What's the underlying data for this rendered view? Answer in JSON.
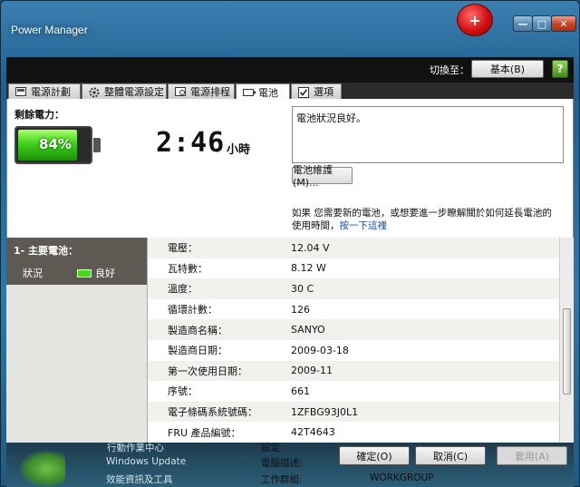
{
  "window": {
    "title": "Power Manager",
    "badge_icon": "battery-plus-icon",
    "min_label": "—",
    "max_label": "□",
    "close_label": "✕"
  },
  "header": {
    "switch_label": "切換至：",
    "basic_button": "基本(B)",
    "help_label": "?"
  },
  "tabs": [
    {
      "label": "電源計劃",
      "icon": "power-plan-icon"
    },
    {
      "label": "整體電源設定",
      "icon": "gear-icon"
    },
    {
      "label": "電源排程",
      "icon": "schedule-icon"
    },
    {
      "label": "電池",
      "icon": "battery-icon",
      "active": true
    },
    {
      "label": "選項",
      "icon": "checkbox-icon"
    }
  ],
  "battery": {
    "remaining_label": "剩餘電力：",
    "percent_text": "84%",
    "percent_value": 84,
    "time_text": "2:46",
    "time_unit": "小時",
    "status_text": "電池狀況良好。",
    "maintenance_button": "電池維護(M)...",
    "hint_text": "如果 您需要新的電池，或想要進一步瞭解關於如何延長電池的 使用時間，",
    "hint_link": "按一下這裡"
  },
  "left_panel": {
    "title": "1- 主要電池：",
    "status_label": "狀況",
    "status_value": "良好"
  },
  "properties": [
    {
      "key": "電壓：",
      "value": "12.04 V"
    },
    {
      "key": "瓦特數：",
      "value": "8.12 W"
    },
    {
      "key": "溫度：",
      "value": "30 C"
    },
    {
      "key": "循環計數：",
      "value": "126"
    },
    {
      "key": "製造商名稱：",
      "value": "SANYO"
    },
    {
      "key": "製造商日期：",
      "value": "2009-03-18"
    },
    {
      "key": "第一次使用日期：",
      "value": "2009-11"
    },
    {
      "key": "序號：",
      "value": "661"
    },
    {
      "key": "電子條碼系統號碼：",
      "value": "1ZFBG93J0L1"
    },
    {
      "key": "FRU 產品編號：",
      "value": "42T4643"
    }
  ],
  "footer": {
    "ok": "確定(O)",
    "cancel": "取消(C)",
    "apply": "套用(A)"
  },
  "background": {
    "item1": "行動作業中心",
    "item2": "Windows Update",
    "item3": "效能資訊及工具",
    "item4": "電腦描述:",
    "item5": "工作群組:",
    "item6": "WORKGROUP",
    "item7": "設定"
  },
  "colors": {
    "battery_green": "#40d21a",
    "link_blue": "#1a4fb0",
    "badge_red": "#d01010"
  }
}
